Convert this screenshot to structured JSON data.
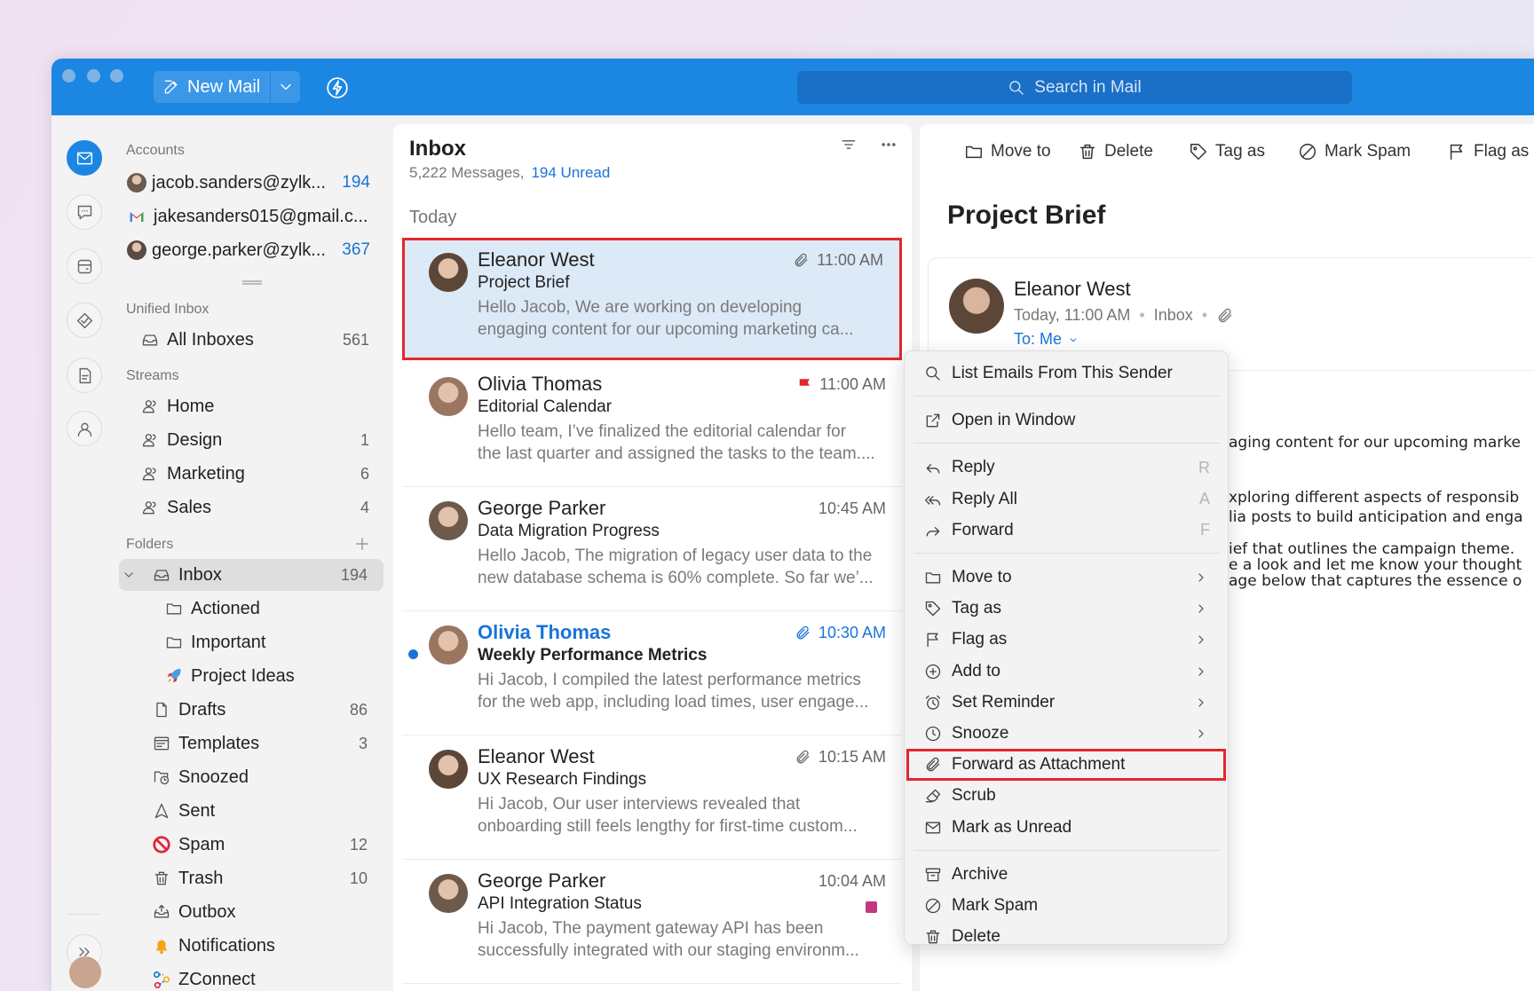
{
  "toolbar": {
    "new_mail": "New Mail",
    "search_placeholder": "Search in Mail"
  },
  "sidebar": {
    "accounts": {
      "header": "Accounts",
      "items": [
        {
          "label": "jacob.sanders@zylk...",
          "count": "194",
          "avatar": "#6b5a4e"
        },
        {
          "label": "jakesanders015@gmail.c...",
          "count": "",
          "avatar": "gmail"
        },
        {
          "label": "george.parker@zylk...",
          "count": "367",
          "avatar": "#5a4a45"
        }
      ]
    },
    "unified": {
      "header": "Unified Inbox",
      "items": [
        {
          "label": "All Inboxes",
          "count": "561",
          "icon": "inbox"
        }
      ]
    },
    "streams": {
      "header": "Streams",
      "items": [
        {
          "label": "Home",
          "count": "",
          "icon": "group"
        },
        {
          "label": "Design",
          "count": "1",
          "icon": "group"
        },
        {
          "label": "Marketing",
          "count": "6",
          "icon": "group"
        },
        {
          "label": "Sales",
          "count": "4",
          "icon": "group"
        }
      ]
    },
    "folders": {
      "header": "Folders",
      "items": [
        {
          "label": "Inbox",
          "count": "194",
          "icon": "inbox",
          "level": 0,
          "active": true,
          "expanded": true
        },
        {
          "label": "Actioned",
          "count": "",
          "icon": "folder",
          "level": 1
        },
        {
          "label": "Important",
          "count": "",
          "icon": "folder",
          "level": 1
        },
        {
          "label": "Project Ideas",
          "count": "",
          "icon": "rocket",
          "level": 1
        },
        {
          "label": "Drafts",
          "count": "86",
          "icon": "draft",
          "level": 0
        },
        {
          "label": "Templates",
          "count": "3",
          "icon": "template",
          "level": 0
        },
        {
          "label": "Snoozed",
          "count": "",
          "icon": "snoozed",
          "level": 0
        },
        {
          "label": "Sent",
          "count": "",
          "icon": "sent",
          "level": 0
        },
        {
          "label": "Spam",
          "count": "12",
          "icon": "spam-red",
          "level": 0
        },
        {
          "label": "Trash",
          "count": "10",
          "icon": "trash",
          "level": 0
        },
        {
          "label": "Outbox",
          "count": "",
          "icon": "outbox",
          "level": 0
        },
        {
          "label": "Notifications",
          "count": "",
          "icon": "bell",
          "level": 0
        },
        {
          "label": "ZConnect",
          "count": "",
          "icon": "zconnect",
          "level": 0
        }
      ]
    }
  },
  "rail": [
    "mail",
    "chat",
    "wallet",
    "tasks",
    "notes",
    "contacts"
  ],
  "list": {
    "title": "Inbox",
    "messages_count": "5,222 Messages,",
    "unread": "194 Unread",
    "group": "Today",
    "messages": [
      {
        "sender": "Eleanor West",
        "subject": "Project Brief",
        "preview": [
          "Hello Jacob, We are working on developing",
          "engaging content for our upcoming marketing ca..."
        ],
        "time": "11:00 AM",
        "attachment": true,
        "flag": false,
        "tag_color": "",
        "unread": false,
        "selected": true,
        "avatar": "#5b4638"
      },
      {
        "sender": "Olivia Thomas",
        "subject": "Editorial Calendar",
        "preview": [
          "Hello team, I’ve finalized the editorial calendar for",
          "the last quarter and assigned the tasks to the team...."
        ],
        "time": "11:00 AM",
        "attachment": false,
        "flag": true,
        "tag_color": "",
        "unread": false,
        "selected": false,
        "avatar": "#9a7560"
      },
      {
        "sender": "George Parker",
        "subject": "Data Migration Progress",
        "preview": [
          "Hello Jacob, The migration of legacy user data to the",
          "new database schema is 60% complete. So far we’..."
        ],
        "time": "10:45 AM",
        "attachment": false,
        "flag": false,
        "tag_color": "",
        "unread": false,
        "selected": false,
        "avatar": "#6e5a4a"
      },
      {
        "sender": "Olivia Thomas",
        "subject": "Weekly Performance Metrics",
        "preview": [
          "Hi Jacob, I compiled the latest performance metrics",
          "for the web app, including load times, user engage..."
        ],
        "time": "10:30 AM",
        "attachment": true,
        "flag": false,
        "tag_color": "",
        "unread": true,
        "selected": false,
        "avatar": "#9a7560"
      },
      {
        "sender": "Eleanor West",
        "subject": "UX Research Findings",
        "preview": [
          "Hi Jacob, Our user interviews revealed that",
          "onboarding still feels lengthy for first-time custom..."
        ],
        "time": "10:15 AM",
        "attachment": true,
        "flag": false,
        "tag_color": "",
        "unread": false,
        "selected": false,
        "avatar": "#5b4638"
      },
      {
        "sender": "George Parker",
        "subject": "API Integration Status",
        "preview": [
          "Hi Jacob, The payment gateway API has been",
          "successfully integrated with our staging environm..."
        ],
        "time": "10:04 AM",
        "attachment": false,
        "flag": false,
        "tag_color": "#c2387f",
        "unread": false,
        "selected": false,
        "avatar": "#6e5a4a"
      }
    ]
  },
  "reader": {
    "toolbar": [
      {
        "label": "Move to",
        "icon": "folder"
      },
      {
        "label": "Delete",
        "icon": "trash"
      },
      {
        "label": "Tag as",
        "icon": "tag"
      },
      {
        "label": "Mark Spam",
        "icon": "spam"
      },
      {
        "label": "Flag as",
        "icon": "flag"
      }
    ],
    "subject": "Project Brief",
    "sender": "Eleanor West",
    "date": "Today, 11:00 AM",
    "folder": "Inbox",
    "to": "To: Me",
    "body_fragments": [
      "aging content for our upcoming marke",
      "xploring different aspects of responsib",
      "lia posts to build anticipation and enga",
      "ief that outlines the campaign theme.",
      "e a look and let me know your thought",
      "age below that captures the essence o"
    ]
  },
  "context_menu": {
    "groups": [
      [
        {
          "label": "List Emails From This Sender",
          "icon": "search"
        }
      ],
      [
        {
          "label": "Open in Window",
          "icon": "external"
        }
      ],
      [
        {
          "label": "Reply",
          "icon": "reply",
          "shortcut": "R"
        },
        {
          "label": "Reply All",
          "icon": "replyall",
          "shortcut": "A"
        },
        {
          "label": "Forward",
          "icon": "forward",
          "shortcut": "F"
        }
      ],
      [
        {
          "label": "Move to",
          "icon": "folder",
          "submenu": true
        },
        {
          "label": "Tag as",
          "icon": "tag",
          "submenu": true
        },
        {
          "label": "Flag as",
          "icon": "flag",
          "submenu": true
        },
        {
          "label": "Add to",
          "icon": "plus-circle",
          "submenu": true
        },
        {
          "label": "Set Reminder",
          "icon": "alarm",
          "submenu": true
        },
        {
          "label": "Snooze",
          "icon": "clock",
          "submenu": true
        },
        {
          "label": "Forward as Attachment",
          "icon": "paperclip",
          "highlighted": true
        },
        {
          "label": "Scrub",
          "icon": "scrub"
        },
        {
          "label": "Mark as Unread",
          "icon": "mail"
        }
      ],
      [
        {
          "label": "Archive",
          "icon": "archive"
        },
        {
          "label": "Mark Spam",
          "icon": "spam"
        },
        {
          "label": "Delete",
          "icon": "trash"
        }
      ]
    ]
  },
  "colors": {
    "accent": "#1c87e3",
    "highlight": "#e5262c",
    "selected_bg": "#dce9f7",
    "flag": "#e5262c",
    "link": "#1a73d9"
  }
}
